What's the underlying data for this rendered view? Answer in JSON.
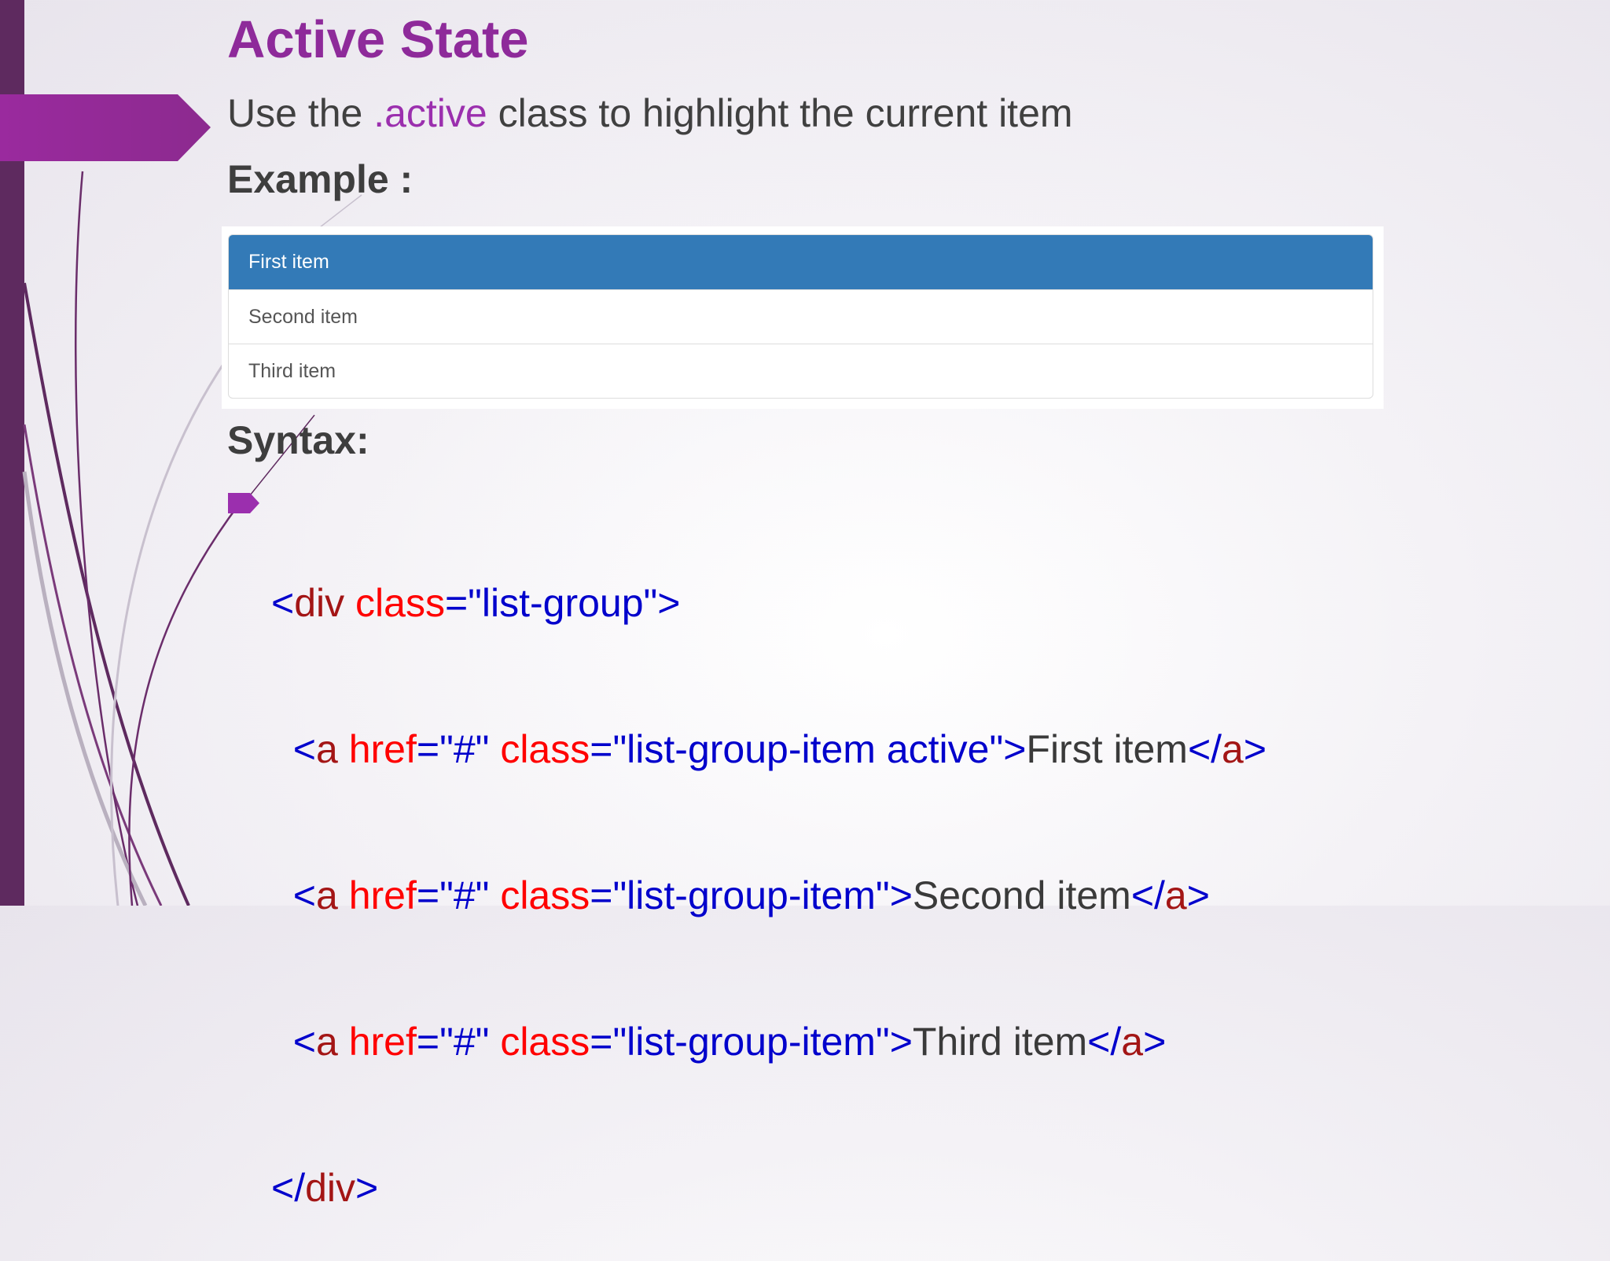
{
  "slide": {
    "title": "Active State",
    "subtitle": {
      "before": "Use the ",
      "highlight": ".active",
      "after": " class to highlight the current item"
    },
    "example_label": "Example :",
    "syntax_label": "Syntax:"
  },
  "example": {
    "items": [
      {
        "label": "First item",
        "active": true
      },
      {
        "label": "Second item",
        "active": false
      },
      {
        "label": "Third item",
        "active": false
      }
    ]
  },
  "code": {
    "lines": [
      [
        "",
        "<",
        "div",
        " ",
        "class",
        "=",
        "\"list-group\"",
        ">",
        "",
        "",
        "",
        ""
      ],
      [
        "  ",
        "<",
        "a",
        " ",
        "href",
        "=",
        "\"#\"",
        " ",
        "class",
        "=",
        "\"list-group-item active\"",
        ">",
        "First item",
        "</",
        "a",
        ">"
      ],
      [
        "  ",
        "<",
        "a",
        " ",
        "href",
        "=",
        "\"#\"",
        " ",
        "class",
        "=",
        "\"list-group-item\"",
        ">",
        "Second item",
        "</",
        "a",
        ">"
      ],
      [
        "  ",
        "<",
        "a",
        " ",
        "href",
        "=",
        "\"#\"",
        " ",
        "class",
        "=",
        "\"list-group-item\"",
        ">",
        "Third item",
        "</",
        "a",
        ">"
      ],
      [
        "",
        "</",
        "div",
        ">"
      ]
    ]
  },
  "colors": {
    "title": "#8e2a9a",
    "accent": "#9b2fae",
    "active_item_bg": "#337ab7",
    "code_punct": "#0000cc",
    "code_tag": "#a31515",
    "code_attr": "#ff0000",
    "code_value": "#0000cc",
    "code_text": "#3a3a3a"
  }
}
